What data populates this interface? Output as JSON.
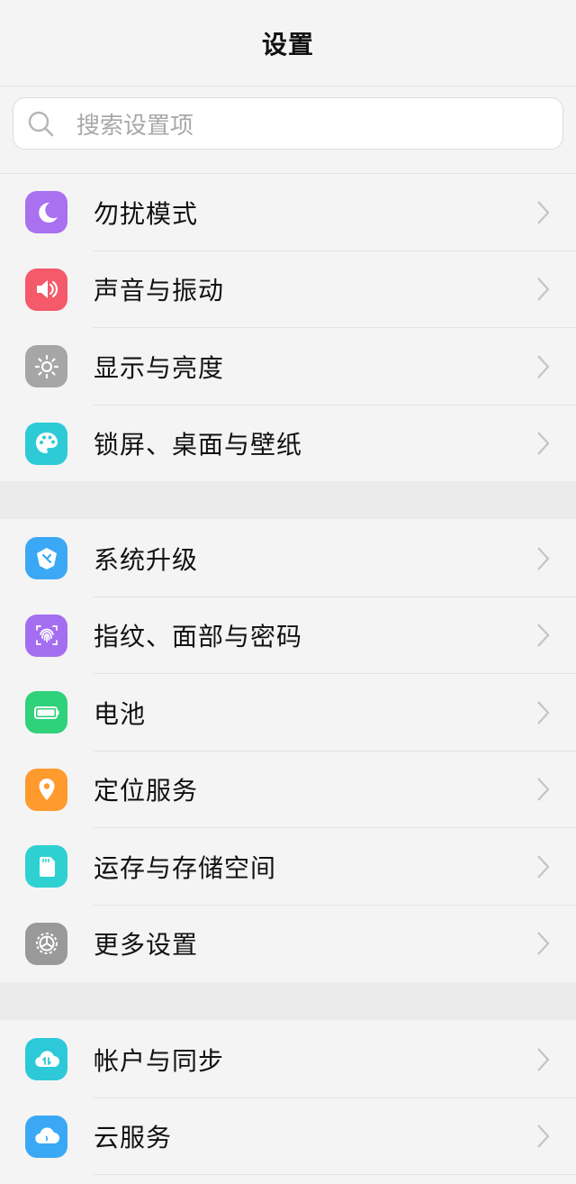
{
  "header": {
    "title": "设置"
  },
  "search": {
    "placeholder": "搜索设置项"
  },
  "groups": [
    {
      "items": [
        {
          "label": "勿扰模式",
          "icon": "moon-icon",
          "color": "#a970f0"
        },
        {
          "label": "声音与振动",
          "icon": "speaker-icon",
          "color": "#f45a6a"
        },
        {
          "label": "显示与亮度",
          "icon": "sun-icon",
          "color": "#a6a6a6"
        },
        {
          "label": "锁屏、桌面与壁纸",
          "icon": "palette-icon",
          "color": "#2ecad6"
        }
      ]
    },
    {
      "items": [
        {
          "label": "系统升级",
          "icon": "system-update-icon",
          "color": "#3aa8f5"
        },
        {
          "label": "指纹、面部与密码",
          "icon": "fingerprint-icon",
          "color": "#a56ef0"
        },
        {
          "label": "电池",
          "icon": "battery-icon",
          "color": "#2fd17a"
        },
        {
          "label": "定位服务",
          "icon": "location-pin-icon",
          "color": "#ff9a2e"
        },
        {
          "label": "运存与存储空间",
          "icon": "sd-card-icon",
          "color": "#2ed0d0"
        },
        {
          "label": "更多设置",
          "icon": "gear-icon",
          "color": "#999999"
        }
      ]
    },
    {
      "items": [
        {
          "label": "帐户与同步",
          "icon": "cloud-sync-icon",
          "color": "#2dc9d8"
        },
        {
          "label": "云服务",
          "icon": "cloud-icon",
          "color": "#3aa8f5"
        }
      ]
    }
  ]
}
